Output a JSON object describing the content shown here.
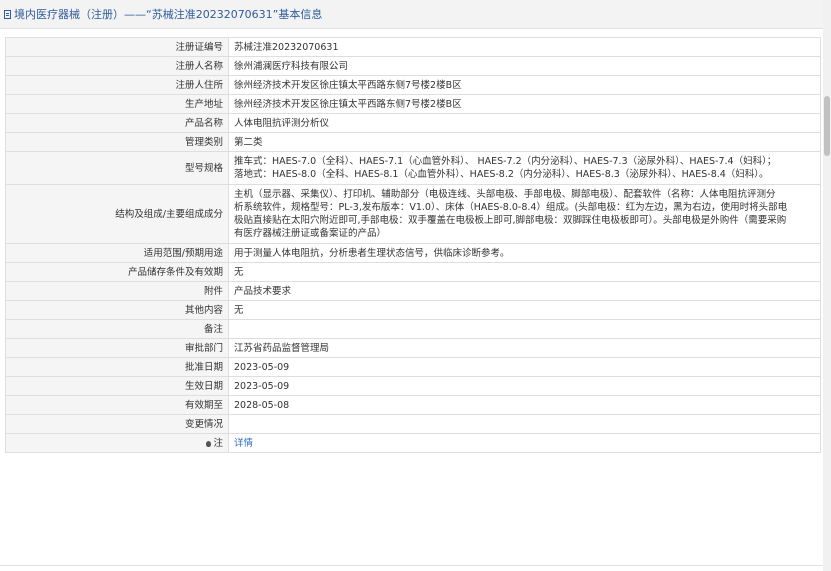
{
  "header": {
    "title": "境内医疗器械（注册）——“苏械注准20232070631”基本信息"
  },
  "rows": [
    {
      "label": "注册证编号",
      "value": "苏械注准20232070631"
    },
    {
      "label": "注册人名称",
      "value": "徐州浦澜医疗科技有限公司"
    },
    {
      "label": "注册人住所",
      "value": "徐州经济技术开发区徐庄镇太平西路东侧7号楼2楼B区"
    },
    {
      "label": "生产地址",
      "value": "徐州经济技术开发区徐庄镇太平西路东侧7号楼2楼B区"
    },
    {
      "label": "产品名称",
      "value": "人体电阻抗评测分析仪"
    },
    {
      "label": "管理类别",
      "value": "第二类"
    },
    {
      "label": "型号规格",
      "lines": [
        "推车式：HAES-7.0（全科）、HAES-7.1（心血管外科）、 HAES-7.2（内分泌科）、HAES-7.3（泌尿外科）、HAES-7.4（妇科）；",
        "落地式：HAES-8.0（全科、HAES-8.1（心血管外科）、HAES-8.2（内分泌科）、HAES-8.3（泌尿外科）、HAES-8.4（妇科）。"
      ]
    },
    {
      "label": "结构及组成/主要组成成分",
      "lines": [
        "主机（显示器、采集仪）、打印机、辅助部分（电极连线、头部电极、手部电极、脚部电极）、配套软件（名称：人体电阻抗评测分",
        "析系统软件，规格型号：PL-3,发布版本：V1.0）、床体（HAES-8.0-8.4）组成。(头部电极：红为左边，黑为右边，使用时将头部电",
        "极贴直接贴在太阳穴附近即可,手部电极：双手覆盖在电极板上即可,脚部电极：双脚踩住电极板即可）。头部电极是外购件（需要采购",
        "有医疗器械注册证或备案证的产品）"
      ]
    },
    {
      "label": "适用范围/预期用途",
      "value": "用于测量人体电阻抗，分析患者生理状态信号，供临床诊断参考。"
    },
    {
      "label": "产品储存条件及有效期",
      "value": "无"
    },
    {
      "label": "附件",
      "value": "产品技术要求"
    },
    {
      "label": "其他内容",
      "value": "无"
    },
    {
      "label": "备注",
      "value": ""
    },
    {
      "label": "审批部门",
      "value": "江苏省药品监督管理局"
    },
    {
      "label": "批准日期",
      "value": "2023-05-09"
    },
    {
      "label": "生效日期",
      "value": "2023-05-09"
    },
    {
      "label": "有效期至",
      "value": "2028-05-08"
    },
    {
      "label": "变更情况",
      "value": ""
    },
    {
      "label": "注",
      "value": "详情"
    }
  ],
  "icons": {
    "header": "document-icon",
    "note": "lightbulb-icon"
  },
  "colors": {
    "link": "#2e6fbf",
    "header_text": "#2e5c9a",
    "label_bg": "#f5f5f5",
    "border": "#dedede"
  }
}
